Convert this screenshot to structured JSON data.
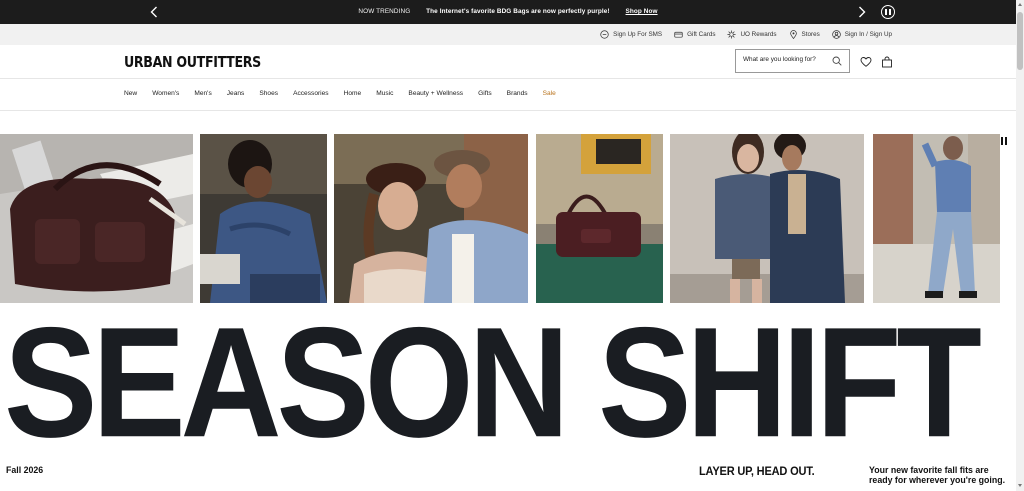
{
  "promo": {
    "trending_label": "NOW TRENDING",
    "headline": "The Internet's favorite BDG Bags are now perfectly purple!",
    "link": "Shop Now"
  },
  "utility": [
    {
      "label": "Sign Up For SMS",
      "icon": "sms-icon"
    },
    {
      "label": "Gift Cards",
      "icon": "gift-card-icon"
    },
    {
      "label": "UO Rewards",
      "icon": "rewards-icon"
    },
    {
      "label": "Stores",
      "icon": "location-pin-icon"
    },
    {
      "label": "Sign In / Sign Up",
      "icon": "user-icon"
    }
  ],
  "header": {
    "logo": "URBAN OUTFITTERS",
    "search_placeholder": "What are you looking for?"
  },
  "nav": [
    "New",
    "Women's",
    "Men's",
    "Jeans",
    "Shoes",
    "Accessories",
    "Home",
    "Music",
    "Beauty + Wellness",
    "Gifts",
    "Brands",
    "Sale"
  ],
  "hero": {
    "headline": "SEASON SHIFT",
    "season": "Fall 2026",
    "tagline": "LAYER UP, HEAD OUT.",
    "subline": "Your new favorite fall fits are ready for wherever you're going."
  },
  "colors": {
    "promo_bg": "#1c1c1c",
    "utility_bg": "#f1f1f1",
    "sale": "#b9741e",
    "headline": "#1a1d22"
  }
}
